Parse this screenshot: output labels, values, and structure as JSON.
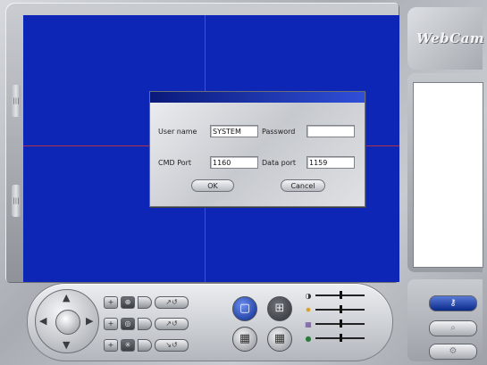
{
  "app": {
    "logo_text": "WebCam"
  },
  "dialog": {
    "username_label": "User name",
    "username_value": "SYSTEM",
    "password_label": "Password",
    "password_value": "",
    "cmd_port_label": "CMD Port",
    "cmd_port_value": "1160",
    "data_port_label": "Data port",
    "data_port_value": "1159",
    "ok_label": "OK",
    "cancel_label": "Cancel"
  },
  "controls": {
    "layout_buttons": [
      "single-view",
      "quad-view",
      "nine-view",
      "sixteen-view"
    ],
    "sliders": [
      {
        "icon": "contrast-icon",
        "glyph": "◑",
        "value": 0.5
      },
      {
        "icon": "brightness-icon",
        "glyph": "✹",
        "value": 0.5
      },
      {
        "icon": "saturation-icon",
        "glyph": "▦",
        "value": 0.5
      },
      {
        "icon": "hue-icon",
        "glyph": "●",
        "value": 0.5
      }
    ]
  },
  "right_buttons": [
    {
      "icon": "key-icon",
      "glyph": "⚷",
      "active": true
    },
    {
      "icon": "search-icon",
      "glyph": "⌕",
      "active": false
    },
    {
      "icon": "settings-icon",
      "glyph": "⚙",
      "active": false
    }
  ],
  "colors": {
    "video_bg": "#0d26b5",
    "grid_line": "#b2304a",
    "title_bar": "#0a1a7a"
  }
}
